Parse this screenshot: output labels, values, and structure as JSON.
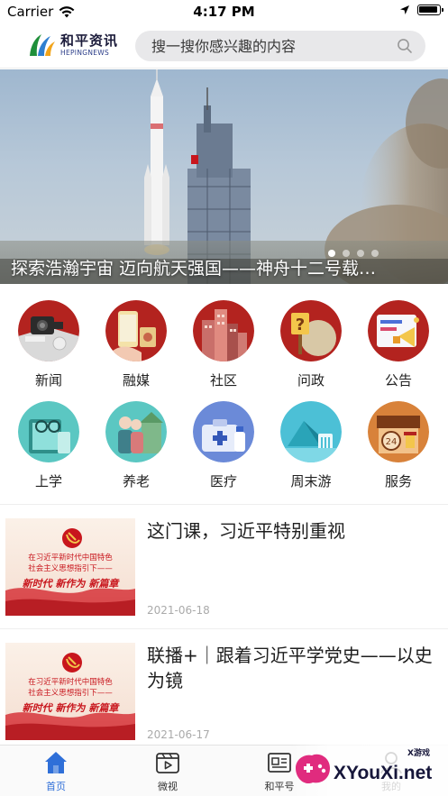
{
  "status_bar": {
    "carrier": "Carrier",
    "time": "4:17 PM"
  },
  "header": {
    "logo_cn": "和平资讯",
    "logo_en": "HEPINGNEWS",
    "search_placeholder": "搜一搜你感兴趣的内容"
  },
  "banner": {
    "title": "探索浩瀚宇宙 迈向航天强国——神舟十二号载…",
    "dots": 4,
    "active_dot": 0
  },
  "categories": [
    {
      "label": "新闻",
      "icon": "news-icon"
    },
    {
      "label": "融媒",
      "icon": "media-icon"
    },
    {
      "label": "社区",
      "icon": "community-icon"
    },
    {
      "label": "问政",
      "icon": "inquiry-icon"
    },
    {
      "label": "公告",
      "icon": "announcement-icon"
    },
    {
      "label": "上学",
      "icon": "school-icon"
    },
    {
      "label": "养老",
      "icon": "elderly-icon"
    },
    {
      "label": "医疗",
      "icon": "medical-icon"
    },
    {
      "label": "周末游",
      "icon": "travel-icon"
    },
    {
      "label": "服务",
      "icon": "service-icon"
    }
  ],
  "news": [
    {
      "title": "这门课，习近平特别重视",
      "date": "2021-06-18",
      "thumb_line1": "在习近平新时代中国特色",
      "thumb_line2": "社会主义思想指引下——",
      "thumb_slogan": "新时代 新作为 新篇章"
    },
    {
      "title": "联播+｜跟着习近平学党史——以史为镜",
      "date": "2021-06-17",
      "thumb_line1": "在习近平新时代中国特色",
      "thumb_line2": "社会主义思想指引下——",
      "thumb_slogan": "新时代 新作为 新篇章"
    }
  ],
  "tabbar": [
    {
      "label": "首页",
      "icon": "home-icon",
      "active": true
    },
    {
      "label": "微视",
      "icon": "video-icon",
      "active": false
    },
    {
      "label": "和平号",
      "icon": "account-icon",
      "active": false
    },
    {
      "label": "我的",
      "icon": "profile-icon",
      "active": false
    }
  ],
  "watermark": {
    "brand": "XYouXi.net",
    "tag": "X游戏"
  },
  "colors": {
    "accent": "#2f6fd8",
    "party_red": "#c8161d",
    "gold": "#f3c64b"
  }
}
